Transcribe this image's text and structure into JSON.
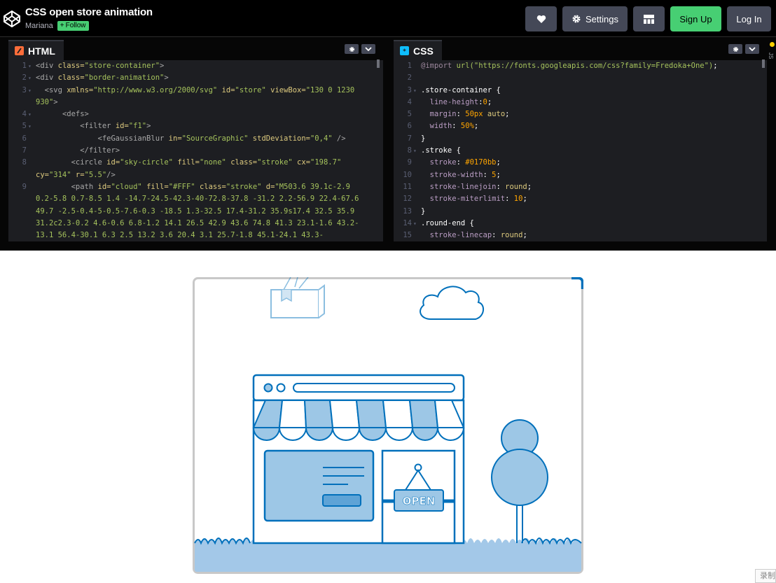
{
  "header": {
    "title": "CSS open store animation",
    "author": "Mariana",
    "follow_label": "Follow",
    "settings_label": "Settings",
    "signup_label": "Sign Up",
    "login_label": "Log In"
  },
  "html_pane": {
    "tab_label": "HTML",
    "accent": "#ff6d3a",
    "lines": [
      {
        "n": "1",
        "fold": "▾",
        "html": "<span class=\"c-tag\">&lt;div</span> <span class=\"c-attr\">class=</span><span class=\"c-val\">\"store-container\"</span><span class=\"c-tag\">&gt;</span>"
      },
      {
        "n": "2",
        "fold": "▾",
        "html": "<span class=\"c-tag\">&lt;div</span> <span class=\"c-attr\">class=</span><span class=\"c-val\">\"border-animation\"</span><span class=\"c-tag\">&gt;</span>"
      },
      {
        "n": "3",
        "fold": "▾",
        "html": "  <span class=\"c-tag\">&lt;svg</span> <span class=\"c-attr\">xmlns=</span><span class=\"c-val\">\"http://www.w3.org/2000/svg\"</span> <span class=\"c-attr\">id=</span><span class=\"c-val\">\"store\"</span> <span class=\"c-attr\">viewBox=</span><span class=\"c-val\">\"130 0 1230</span>"
      },
      {
        "n": "",
        "fold": "",
        "html": "<span class=\"c-val\">930\"</span><span class=\"c-tag\">&gt;</span>"
      },
      {
        "n": "4",
        "fold": "▾",
        "html": "      <span class=\"c-tag\">&lt;defs&gt;</span>"
      },
      {
        "n": "5",
        "fold": "▾",
        "html": "          <span class=\"c-tag\">&lt;filter</span> <span class=\"c-attr\">id=</span><span class=\"c-val\">\"f1\"</span><span class=\"c-tag\">&gt;</span>"
      },
      {
        "n": "6",
        "fold": "",
        "html": "              <span class=\"c-tag\">&lt;feGaussianBlur</span> <span class=\"c-attr\">in=</span><span class=\"c-val\">\"SourceGraphic\"</span> <span class=\"c-attr\">stdDeviation=</span><span class=\"c-val\">\"0,4\"</span> <span class=\"c-tag\">/&gt;</span>"
      },
      {
        "n": "7",
        "fold": "",
        "html": "          <span class=\"c-tag\">&lt;/filter&gt;</span>"
      },
      {
        "n": "8",
        "fold": "",
        "html": "        <span class=\"c-tag\">&lt;circle</span> <span class=\"c-attr\">id=</span><span class=\"c-val\">\"sky-circle\"</span> <span class=\"c-attr\">fill=</span><span class=\"c-val\">\"none\"</span> <span class=\"c-attr\">class=</span><span class=\"c-val\">\"stroke\"</span> <span class=\"c-attr\">cx=</span><span class=\"c-val\">\"198.7\"</span>"
      },
      {
        "n": "",
        "fold": "",
        "html": "<span class=\"c-attr\">cy=</span><span class=\"c-val\">\"314\"</span> <span class=\"c-attr\">r=</span><span class=\"c-val\">\"5.5\"</span><span class=\"c-tag\">/&gt;</span>"
      },
      {
        "n": "9",
        "fold": "",
        "html": "        <span class=\"c-tag\">&lt;path</span> <span class=\"c-attr\">id=</span><span class=\"c-val\">\"cloud\"</span> <span class=\"c-attr\">fill=</span><span class=\"c-val\">\"#FFF\"</span> <span class=\"c-attr\">class=</span><span class=\"c-val\">\"stroke\"</span> <span class=\"c-attr\">d=</span><span class=\"c-val\">\"M503.6 39.1c-2.9</span>"
      },
      {
        "n": "",
        "fold": "",
        "html": "<span class=\"c-val\">0.2-5.8 0.7-8.5 1.4 -14.7-24.5-42.3-40-72.8-37.8 -31.2 2.2-56.9 22.4-67.6</span>"
      },
      {
        "n": "",
        "fold": "",
        "html": "<span class=\"c-val\">49.7 -2.5-0.4-5-0.5-7.6-0.3 -18.5 1.3-32.5 17.4-31.2 35.9s17.4 32.5 35.9</span>"
      },
      {
        "n": "",
        "fold": "",
        "html": "<span class=\"c-val\">31.2c2.3-0.2 4.6-0.6 6.8-1.2 14.1 26.5 42.9 43.6 74.8 41.3 23.1-1.6 43.2-</span>"
      },
      {
        "n": "",
        "fold": "",
        "html": "<span class=\"c-val\">13.1 56.4-30.1 6.3 2.5 13.2 3.6 20.4 3.1 25.7-1.8 45.1-24.1 43.3-</span>"
      }
    ]
  },
  "css_pane": {
    "tab_label": "CSS",
    "accent": "#0ebeff",
    "lines": [
      {
        "n": "1",
        "fold": "",
        "html": "<span class=\"c-at\">@import</span> <span class=\"c-url\">url(\"https://fonts.googleapis.com/css?family=Fredoka+One\")</span><span class=\"c-sel\">;</span>"
      },
      {
        "n": "2",
        "fold": "",
        "html": ""
      },
      {
        "n": "3",
        "fold": "▾",
        "html": "<span class=\"c-sel\">.store-container {</span>"
      },
      {
        "n": "4",
        "fold": "",
        "html": "  <span class=\"c-prop\">line-height</span><span class=\"c-sel\">:</span><span class=\"c-num\">0</span><span class=\"c-sel\">;</span>"
      },
      {
        "n": "5",
        "fold": "",
        "html": "  <span class=\"c-prop\">margin</span><span class=\"c-sel\">:</span> <span class=\"c-num\">50px</span> <span class=\"c-attr\">auto</span><span class=\"c-sel\">;</span>"
      },
      {
        "n": "6",
        "fold": "",
        "html": "  <span class=\"c-prop\">width</span><span class=\"c-sel\">:</span> <span class=\"c-num\">50%</span><span class=\"c-sel\">;</span>"
      },
      {
        "n": "7",
        "fold": "",
        "html": "<span class=\"c-sel\">}</span>"
      },
      {
        "n": "8",
        "fold": "▾",
        "html": "<span class=\"c-sel\">.stroke {</span>"
      },
      {
        "n": "9",
        "fold": "",
        "html": "  <span class=\"c-prop\">stroke</span><span class=\"c-sel\">:</span> <span class=\"c-num\">#0170bb</span><span class=\"c-sel\">;</span>"
      },
      {
        "n": "10",
        "fold": "",
        "html": "  <span class=\"c-prop\">stroke-width</span><span class=\"c-sel\">:</span> <span class=\"c-num\">5</span><span class=\"c-sel\">;</span>"
      },
      {
        "n": "11",
        "fold": "",
        "html": "  <span class=\"c-prop\">stroke-linejoin</span><span class=\"c-sel\">:</span> <span class=\"c-attr\">round</span><span class=\"c-sel\">;</span>"
      },
      {
        "n": "12",
        "fold": "",
        "html": "  <span class=\"c-prop\">stroke-miterlimit</span><span class=\"c-sel\">:</span> <span class=\"c-num\">10</span><span class=\"c-sel\">;</span>"
      },
      {
        "n": "13",
        "fold": "",
        "html": "<span class=\"c-sel\">}</span>"
      },
      {
        "n": "14",
        "fold": "▾",
        "html": "<span class=\"c-sel\">.round-end {</span>"
      },
      {
        "n": "15",
        "fold": "",
        "html": "  <span class=\"c-prop\">stroke-linecap</span><span class=\"c-sel\">:</span> <span class=\"c-attr\">round</span><span class=\"c-sel\">;</span>"
      }
    ]
  },
  "side_strip": {
    "label": "JS"
  },
  "preview": {
    "sign_text": "OPEN",
    "stroke_color": "#0170bb",
    "fill_color": "#9dc7e6",
    "ground_color": "#a3c8e8"
  },
  "corner_label": "录制"
}
